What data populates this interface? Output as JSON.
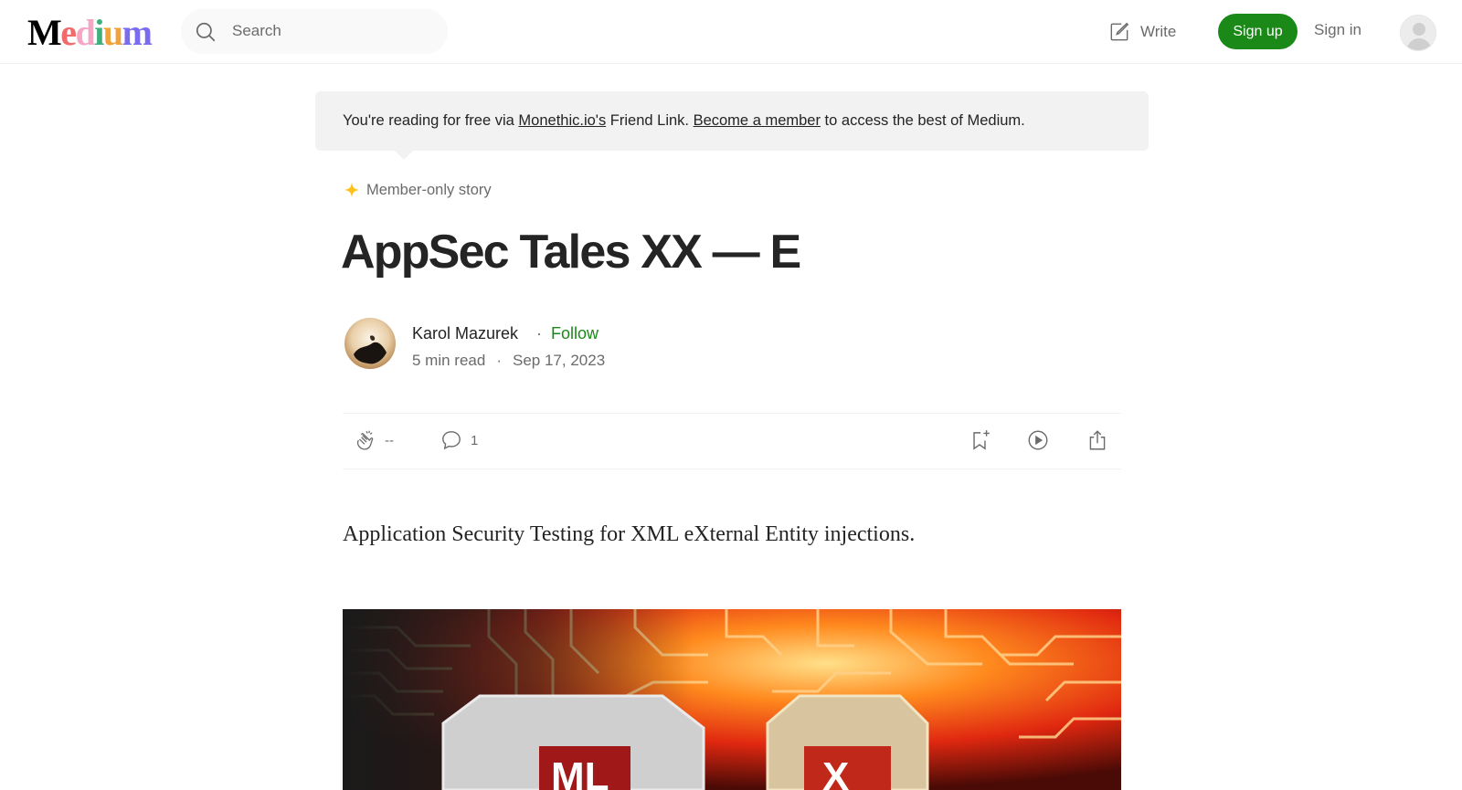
{
  "brand": {
    "logo_letters": [
      "M",
      "e",
      "d",
      "i",
      "u",
      "m"
    ],
    "logo_colors": [
      "#000000",
      "#f26b6b",
      "#f5b0c8",
      "#3fb07c",
      "#f2b23a",
      "#7a6cf0"
    ]
  },
  "header": {
    "search_placeholder": "Search",
    "write_label": "Write",
    "signup_label": "Sign up",
    "signin_label": "Sign in"
  },
  "banner": {
    "prefix": "You're reading for free via ",
    "link1": "Monethic.io's",
    "middle": " Friend Link. ",
    "link2": "Become a member",
    "suffix": " to access the best of Medium."
  },
  "article": {
    "member_label": "Member-only story",
    "title": "AppSec Tales XX — E",
    "author": "Karol Mazurek",
    "separator": "·",
    "follow_label": "Follow",
    "read_time": "5 min read",
    "date": "Sep 17, 2023",
    "claps": "--",
    "comments": "1",
    "subtitle": "Application Security Testing for XML eXternal Entity injections."
  },
  "colors": {
    "accent_green": "#1a8917",
    "star_yellow": "#ffc017",
    "muted_text": "#6b6b6b"
  },
  "icons": [
    "search-icon",
    "write-icon",
    "user-avatar-icon",
    "star-icon",
    "clap-icon",
    "comment-icon",
    "bookmark-icon",
    "play-icon",
    "share-icon"
  ]
}
